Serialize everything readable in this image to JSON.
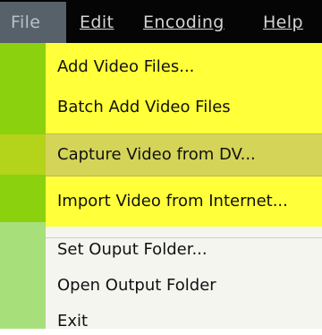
{
  "menubar": {
    "file": "File",
    "edit": "Edit",
    "encoding": "Encoding",
    "help": "Help"
  },
  "file_menu": {
    "items": [
      {
        "label": "Add Video Files...",
        "state": "normal"
      },
      {
        "label": "Batch Add Video Files",
        "state": "normal"
      },
      {
        "label": "Capture Video from DV...",
        "state": "highlighted"
      },
      {
        "label": "Import Video from Internet...",
        "state": "normal"
      },
      {
        "label": "Set Ouput Folder...",
        "state": "normal"
      },
      {
        "label": "Open Output Folder",
        "state": "normal"
      },
      {
        "label": "Exit",
        "state": "normal"
      }
    ]
  },
  "colors": {
    "menubar_bg": "#050505",
    "menubar_text": "#d4d4d4",
    "active_menu_bg": "#56616a",
    "gutter_green": "#8cd10d",
    "item_yellow": "#ffff3a",
    "highlight_bg": "#d4d458",
    "menu_bg": "#f5f5f0"
  }
}
